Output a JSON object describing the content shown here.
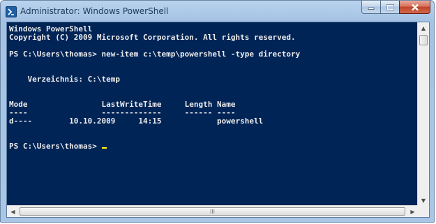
{
  "window": {
    "title": "Administrator: Windows PowerShell",
    "icon": "powershell-icon",
    "controls": {
      "minimize": "minimize-icon",
      "maximize": "maximize-icon",
      "close": "close-icon"
    }
  },
  "console": {
    "background": "#012456",
    "foreground": "#ececec",
    "cursor_color": "#ffff00",
    "lines": [
      "Windows PowerShell",
      "Copyright (C) 2009 Microsoft Corporation. All rights reserved.",
      "",
      "PS C:\\Users\\thomas> new-item c:\\temp\\powershell -type directory",
      "",
      "",
      "    Verzeichnis: C:\\temp",
      "",
      "",
      "Mode                LastWriteTime     Length Name",
      "----                -------------     ------ ----",
      "d----        10.10.2009     14:15            powershell",
      "",
      "",
      "PS C:\\Users\\thomas> "
    ]
  },
  "scrollbars": {
    "horizontal_grip": "III"
  }
}
